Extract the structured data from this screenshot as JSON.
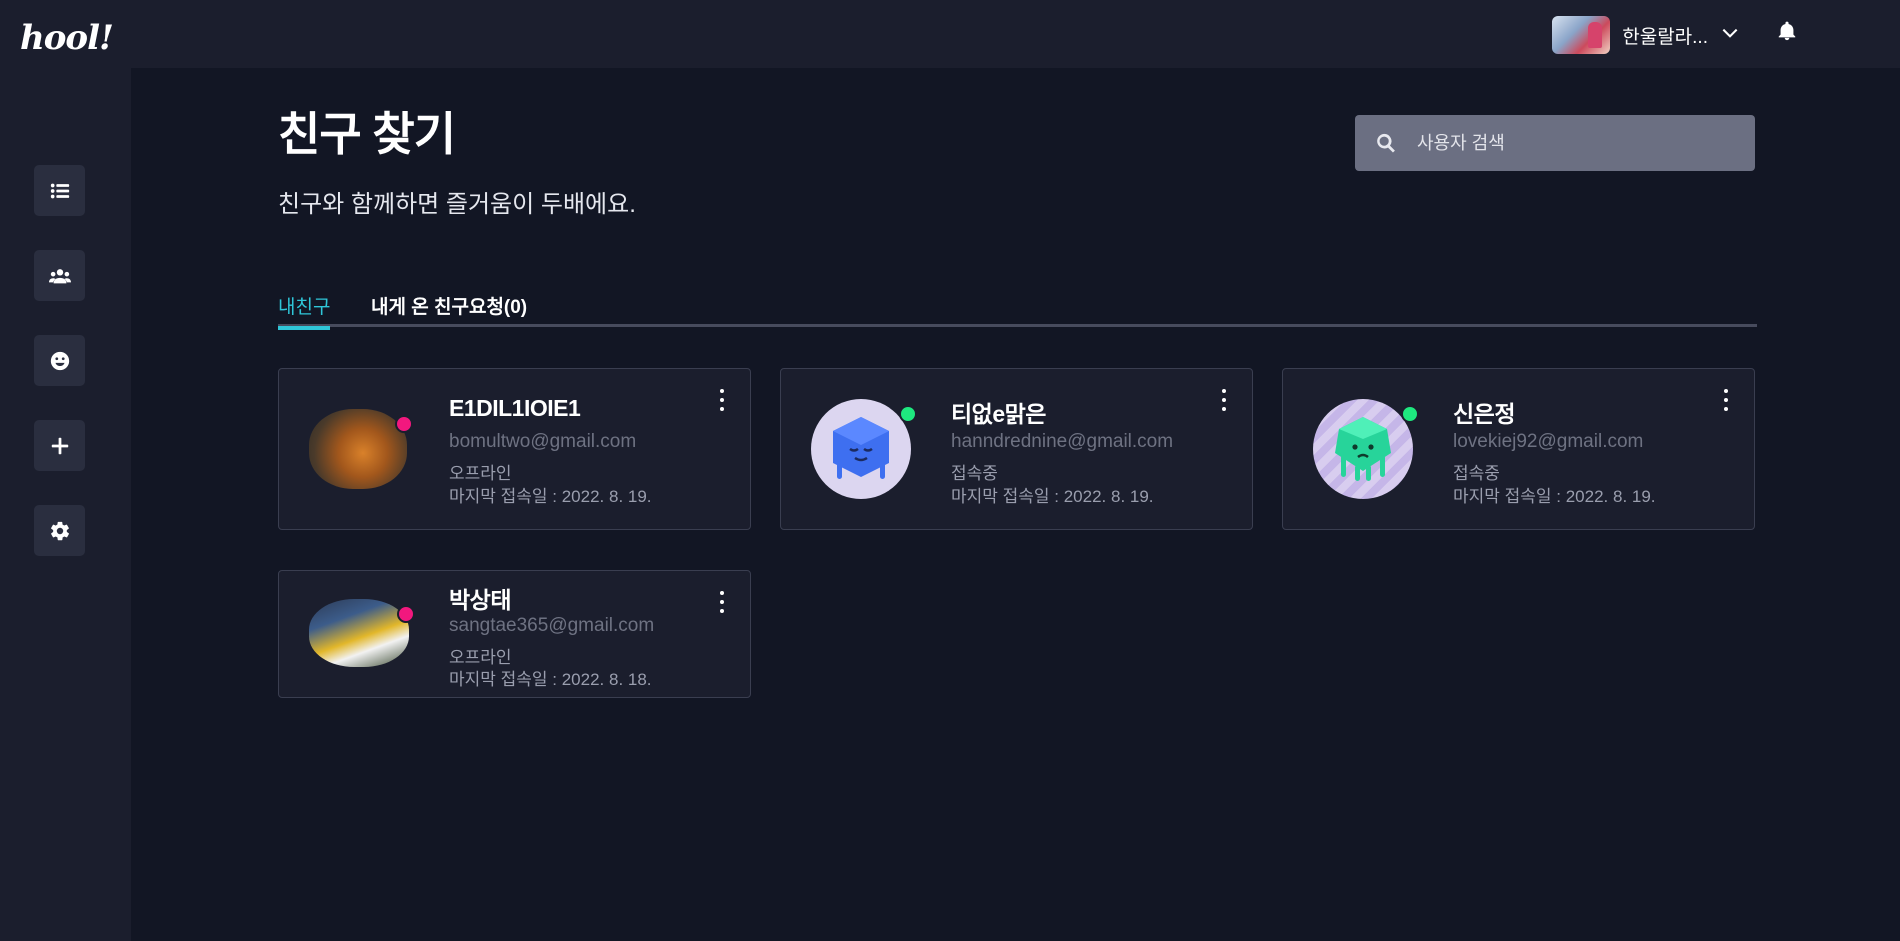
{
  "app": {
    "logo": "hool!"
  },
  "sidebar": {
    "items": [
      {
        "icon": "list-icon"
      },
      {
        "icon": "users-icon"
      },
      {
        "icon": "smile-icon"
      },
      {
        "icon": "plus-icon"
      },
      {
        "icon": "gear-icon"
      }
    ]
  },
  "header": {
    "user_name": "한울랄라...",
    "bell_icon": "bell-icon"
  },
  "main": {
    "title": "친구 찾기",
    "subtitle": "친구와 함께하면 즐거움이 두배에요.",
    "search": {
      "placeholder": "사용자 검색"
    },
    "tabs": [
      {
        "label": "내친구",
        "active": true
      },
      {
        "label": "내게 온 친구요청(0)",
        "active": false
      }
    ],
    "friends": [
      {
        "name": "E1DIL1IOIE1",
        "email": "bomultwo@gmail.com",
        "status": "오프라인",
        "last_seen": "마지막 접속일 : 2022. 8. 19.",
        "online": false
      },
      {
        "name": "티없e맑은",
        "email": "hanndrednine@gmail.com",
        "status": "접속중",
        "last_seen": "마지막 접속일 : 2022. 8. 19.",
        "online": true
      },
      {
        "name": "신은정",
        "email": "lovekiej92@gmail.com",
        "status": "접속중",
        "last_seen": "마지막 접속일 : 2022. 8. 19.",
        "online": true
      },
      {
        "name": "박상태",
        "email": "sangtae365@gmail.com",
        "status": "오프라인",
        "last_seen": "마지막 접속일 : 2022. 8. 18.",
        "online": false
      }
    ]
  },
  "colors": {
    "background": "#121624",
    "panel": "#1b1e2d",
    "accent": "#2fc6d8",
    "online": "#1ee87f",
    "offline": "#f2187e"
  }
}
